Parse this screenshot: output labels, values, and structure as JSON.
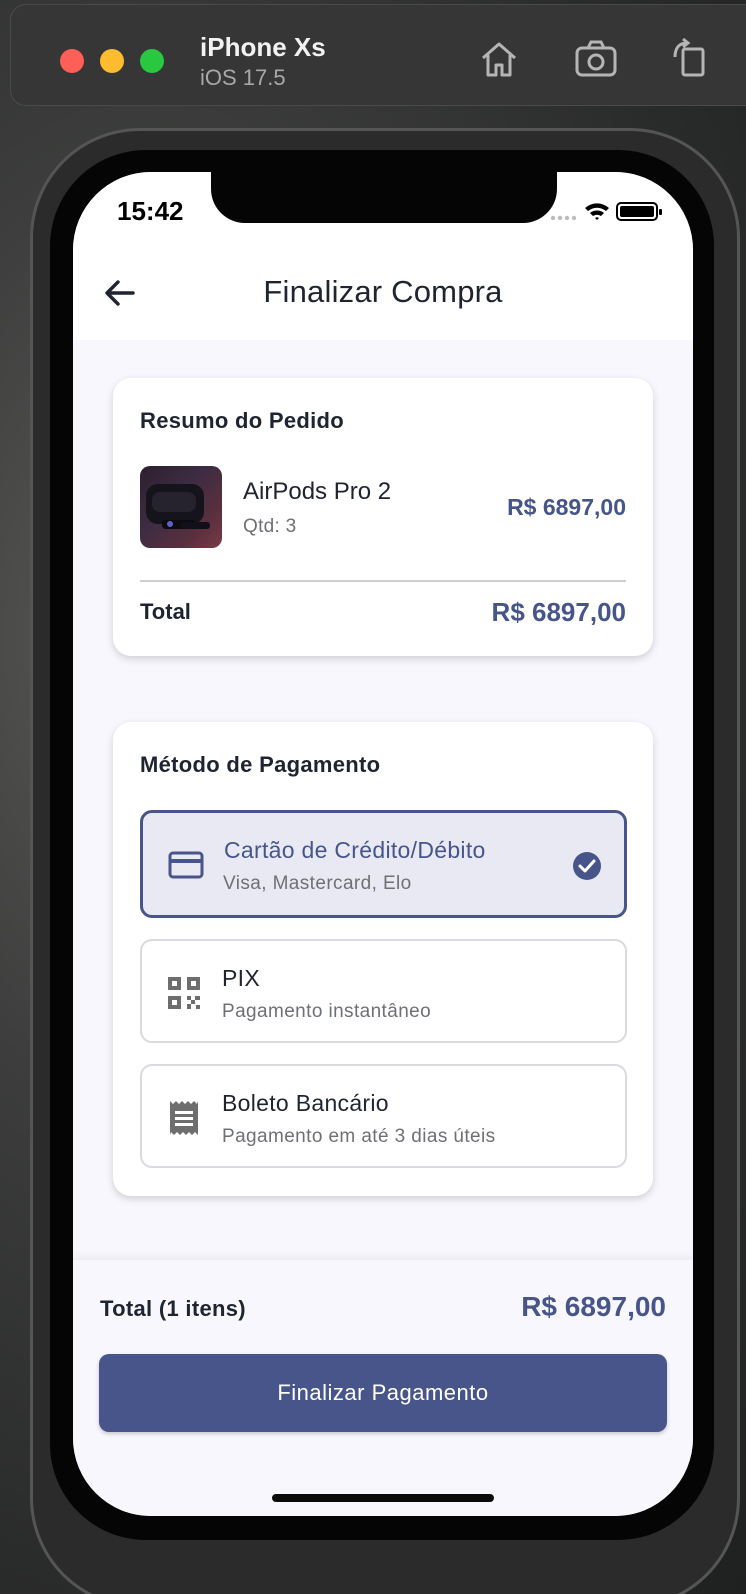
{
  "simulator": {
    "device_name": "iPhone Xs",
    "os_version": "iOS 17.5",
    "icons": [
      "home-icon",
      "screenshot-icon",
      "rotate-icon"
    ]
  },
  "status_bar": {
    "time": "15:42",
    "icons": [
      "signal-icon",
      "wifi-icon",
      "battery-icon"
    ]
  },
  "header": {
    "title": "Finalizar Compra",
    "back_icon": "arrow-left-icon"
  },
  "order_summary": {
    "title": "Resumo do Pedido",
    "item": {
      "name": "AirPods Pro 2",
      "quantity": "Qtd: 3",
      "price": "R$ 6897,00"
    },
    "total_label": "Total",
    "total_value": "R$ 6897,00"
  },
  "payment": {
    "title": "Método de Pagamento",
    "options": [
      {
        "label": "Cartão de Crédito/Débito",
        "description": "Visa, Mastercard, Elo",
        "icon": "credit-card-icon",
        "selected": true
      },
      {
        "label": "PIX",
        "description": "Pagamento instantâneo",
        "icon": "qr-code-icon",
        "selected": false
      },
      {
        "label": "Boleto Bancário",
        "description": "Pagamento em até 3 dias úteis",
        "icon": "receipt-icon",
        "selected": false
      }
    ]
  },
  "footer": {
    "total_label": "Total (1 itens)",
    "total_value": "R$ 6897,00",
    "button_label": "Finalizar Pagamento"
  },
  "colors": {
    "accent": "#47558a",
    "text": "#1f2430",
    "muted": "#6f7075",
    "background": "#f7f7fd",
    "selected_bg": "#e8e9f3"
  }
}
